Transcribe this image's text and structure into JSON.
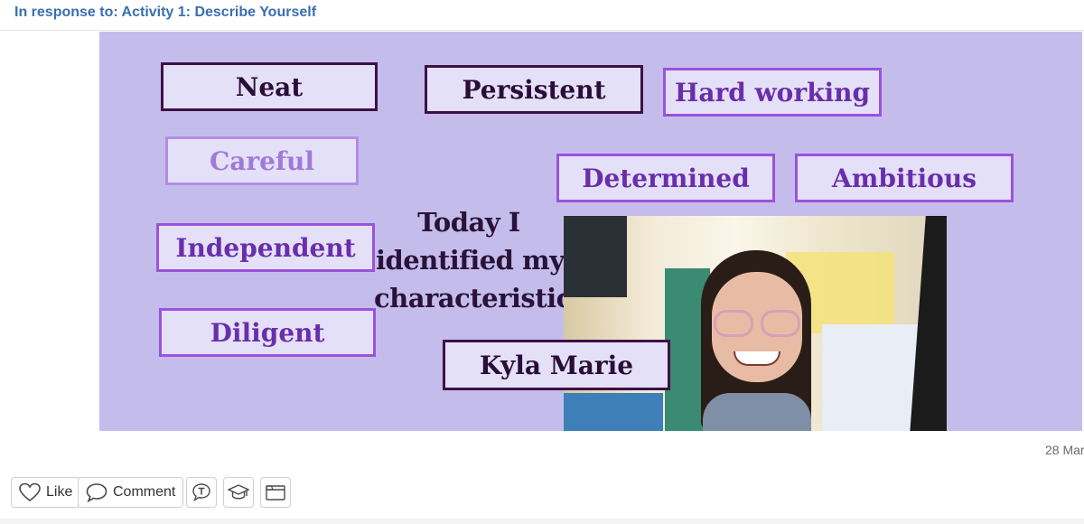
{
  "response": {
    "label": "In response to: Activity 1: Describe Yourself"
  },
  "slide": {
    "words": {
      "neat": "Neat",
      "persistent": "Persistent",
      "hard_working": "Hard working",
      "careful": "Careful",
      "determined": "Determined",
      "ambitious": "Ambitious",
      "independent": "Independent",
      "diligent": "Diligent"
    },
    "statement": [
      "Today I",
      "identified my",
      "characteristics"
    ],
    "name_label": "Kyla Marie"
  },
  "post": {
    "date": "28 Mar"
  },
  "actions": {
    "like_label": "Like",
    "comment_label": "Comment",
    "icons": [
      "heart-icon",
      "speech-bubble-icon",
      "translate-icon",
      "graduation-cap-icon",
      "folder-icon"
    ]
  },
  "colors": {
    "link": "#3a6fb0",
    "slide_bg": "#c4bdec",
    "box_dark": "#3d1146",
    "box_purple": "#9b52dc",
    "box_light": "#b48be8"
  }
}
